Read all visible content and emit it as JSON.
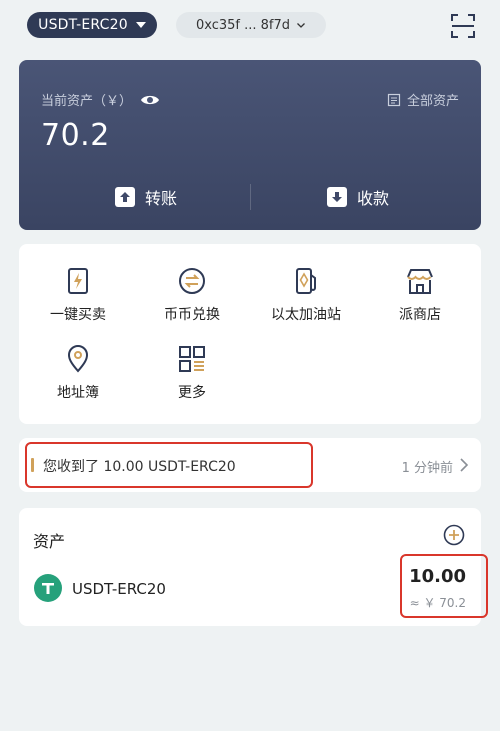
{
  "topbar": {
    "network": "USDT-ERC20",
    "address": "0xc35f ... 8f7d"
  },
  "balance": {
    "label": "当前资产（￥）",
    "all_assets": "全部资产",
    "amount": "70.2",
    "transfer": "转账",
    "receive": "收款"
  },
  "features": [
    {
      "label": "一键买卖",
      "icon": "bolt-card-icon"
    },
    {
      "label": "币币兑换",
      "icon": "swap-icon"
    },
    {
      "label": "以太加油站",
      "icon": "gas-station-icon"
    },
    {
      "label": "派商店",
      "icon": "store-icon"
    },
    {
      "label": "地址簿",
      "icon": "location-pin-icon"
    },
    {
      "label": "更多",
      "icon": "grid-more-icon"
    }
  ],
  "notification": {
    "text": "您收到了 10.00 USDT-ERC20",
    "time": "1 分钟前"
  },
  "assets": {
    "title": "资产",
    "items": [
      {
        "name": "USDT-ERC20",
        "amount": "10.00",
        "fiat": "≈ ￥ 70.2",
        "logo_color": "#26a17b"
      }
    ]
  },
  "colors": {
    "card_bg": "#3f4968",
    "highlight": "#d9362b",
    "accent": "#d0a15a"
  }
}
